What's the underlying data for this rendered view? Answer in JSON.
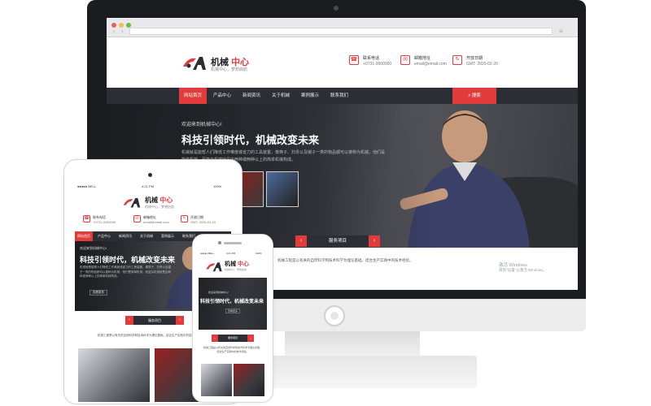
{
  "colors": {
    "accent": "#e23b3b",
    "dark": "#2b2e35",
    "bezel": "#1b1c20"
  },
  "brand": {
    "name_part1": "机械",
    "name_part2": "中心",
    "tagline": "机械中心，梦想启航"
  },
  "contact": {
    "phone_label": "联系电话",
    "phone_value": "+0731-0000000",
    "email_label": "邮箱地址",
    "email_value": "email@email.com",
    "date_label": "开放日期",
    "date_value": "GMT: 2020-02-20"
  },
  "nav": {
    "items": [
      "网站首页",
      "产品中心",
      "新闻资讯",
      "关于机械",
      "案例展示",
      "联系我们"
    ],
    "search_label": "搜索"
  },
  "hero": {
    "welcome": "欢迎来到机械中心!",
    "headline": "科技引领时代，机械改变未来",
    "desc": "机械就是能帮人们降低工作难度或省力的工具装置，像筷子、扫帚以及镊子一类的物品都可以被称为机械，他们是简单机械。而复杂机械就是由两种或两种以上的简单机械构成。",
    "more_label": "查看更多"
  },
  "services": {
    "title": "服务项目",
    "desc": "机械工程是以有关的自然科学和技术科学为理论基础，结合生产实践中的技术经验。"
  },
  "watermark": {
    "line1": "激活 Windows",
    "line2": "转到\"设置\"以激活 Windows。"
  },
  "phone_status": {
    "carrier": "●●●●● BELL",
    "time": "4:21 PM",
    "battery": "100%"
  },
  "icons": [
    "camera-icon",
    "phone-icon",
    "mail-icon",
    "edit-icon",
    "search-icon",
    "chevron-left-icon",
    "chevron-right-icon",
    "power-icon"
  ]
}
